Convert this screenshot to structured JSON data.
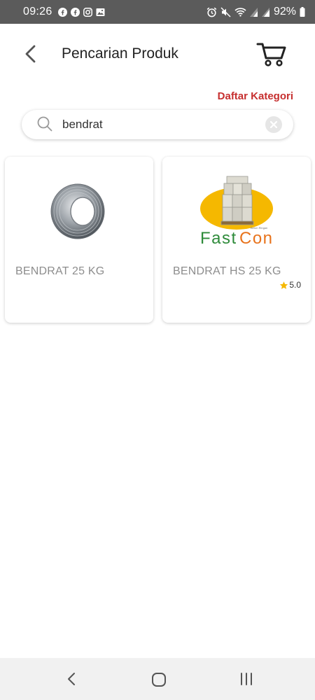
{
  "status_bar": {
    "time": "09:26",
    "battery": "92%",
    "left_icons": [
      "facebook-icon",
      "facebook-icon",
      "instagram-icon",
      "image-icon"
    ],
    "right_icons": [
      "alarm-icon",
      "mute-icon",
      "wifi-icon",
      "signal-icon",
      "signal-icon",
      "battery-icon"
    ]
  },
  "header": {
    "title": "Pencarian Produk",
    "back_icon": "chevron-left-icon",
    "cart_icon": "cart-icon"
  },
  "category_link": "Daftar Kategori",
  "search": {
    "value": "bendrat",
    "icon": "search-icon",
    "clear_icon": "clear-icon"
  },
  "products": [
    {
      "name": "BENDRAT 25 KG",
      "image": "wire-coil-image"
    },
    {
      "name": "BENDRAT HS 25 KG",
      "image": "fastcon-logo-image",
      "logo_text_fast": "Fast",
      "logo_text_con": "Con",
      "logo_tagline": "Beton Ringan",
      "rating": "5.0"
    }
  ],
  "colors": {
    "accent_red": "#c62f2f",
    "logo_green": "#2e8b3a",
    "logo_orange": "#e8731c",
    "logo_yellow": "#f5b800",
    "star": "#f5b800"
  },
  "nav_bar": {
    "icons": [
      "nav-back-icon",
      "nav-home-icon",
      "nav-recents-icon"
    ]
  }
}
